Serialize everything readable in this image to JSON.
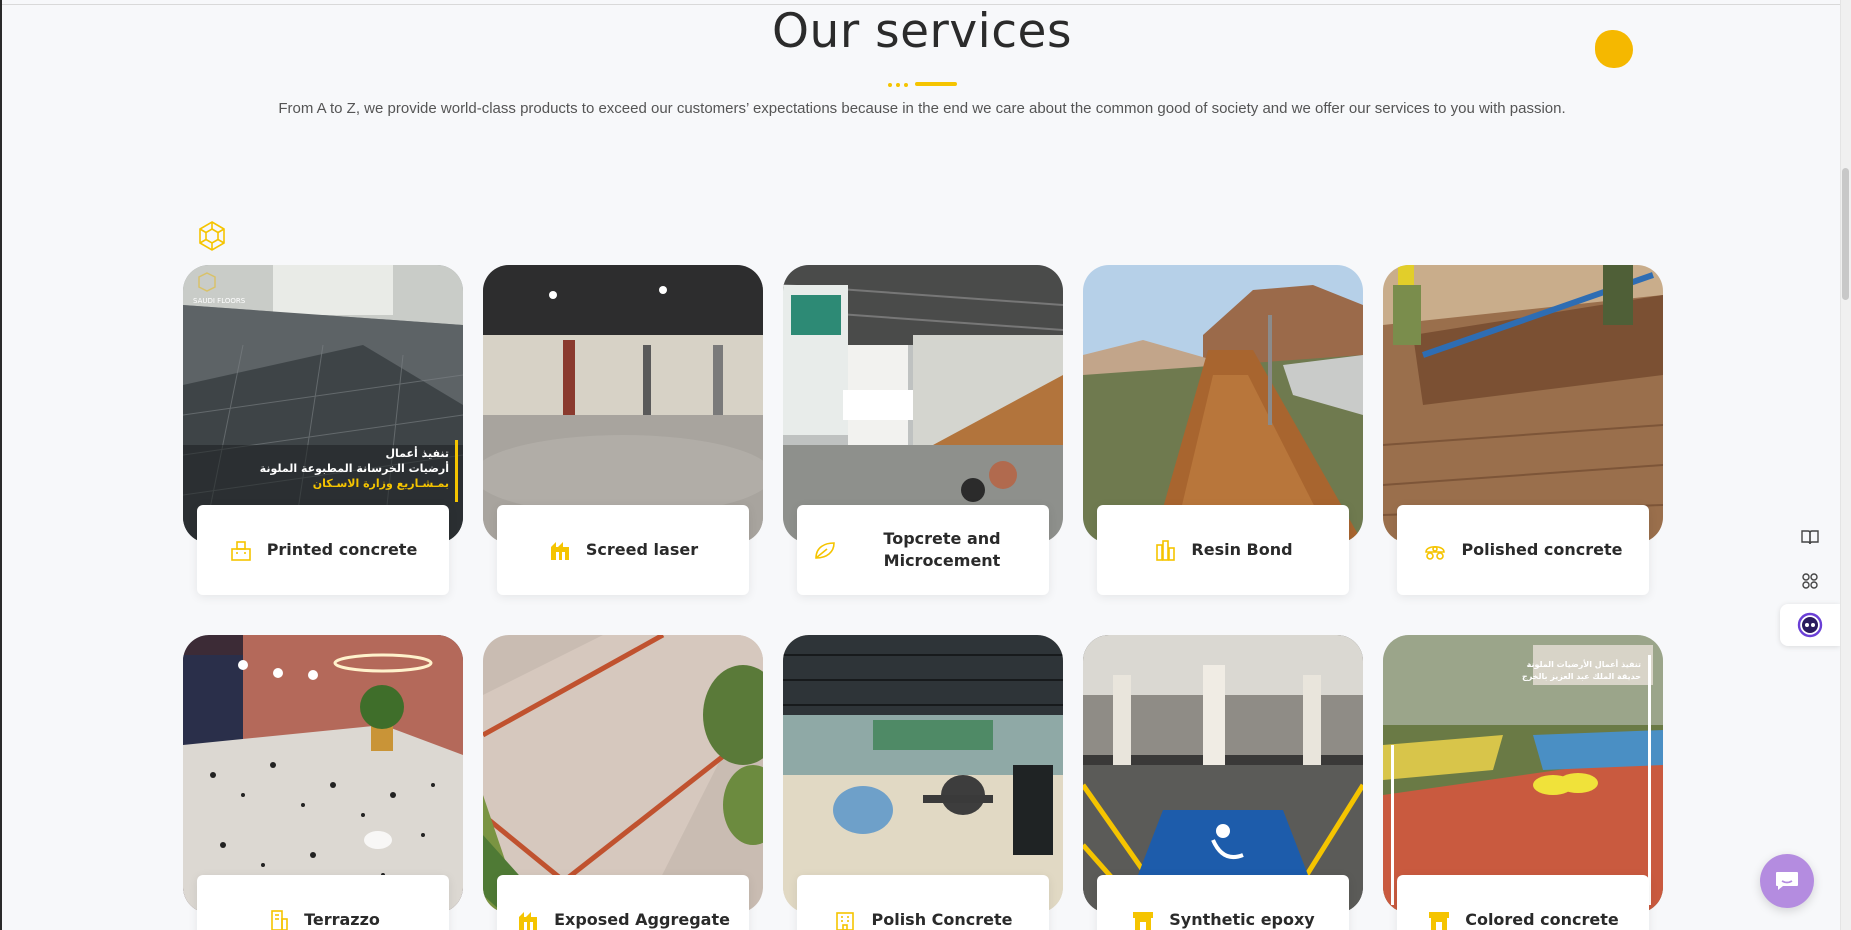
{
  "section": {
    "title": "Our services",
    "subtitle": "From A to Z, we provide world-class products to exceed our customers’ expectations because in the end we care about the common good of society and we offer our services to you with passion."
  },
  "colors": {
    "accent": "#f5c400",
    "chat": "#b48ce0",
    "background": "#f7f8fa"
  },
  "services": [
    {
      "label": "Printed concrete",
      "icon": "building-icon",
      "photo_overlay": [
        "تنفيذ أعمال",
        "أرضيات الخرسانة المطبوعة الملونة",
        "بمـشـاريع وزارة الاسـكان"
      ],
      "brand": "SAUDI FLOORS"
    },
    {
      "label": "Screed laser",
      "icon": "factory-icon"
    },
    {
      "label": "Topcrete and Microcement",
      "icon": "leaf-icon"
    },
    {
      "label": "Resin Bond",
      "icon": "city-icon"
    },
    {
      "label": "Polished concrete",
      "icon": "rover-icon"
    },
    {
      "label": "Terrazzo",
      "icon": "tower-icon"
    },
    {
      "label": "Exposed Aggregate",
      "icon": "factory-icon"
    },
    {
      "label": "Polish Concrete",
      "icon": "office-icon"
    },
    {
      "label": "Synthetic epoxy",
      "icon": "shop-icon"
    },
    {
      "label": "Colored concrete",
      "icon": "shop-icon",
      "photo_overlay": [
        "تنفيذ أعمال الأرضيات الملونة",
        "حديقة الملك عبد العزيز بالخرج"
      ]
    }
  ],
  "side_tools": [
    {
      "name": "book-icon"
    },
    {
      "name": "apps-icon"
    },
    {
      "name": "assistant-icon"
    }
  ],
  "chat_button": {
    "name": "chat-icon"
  }
}
